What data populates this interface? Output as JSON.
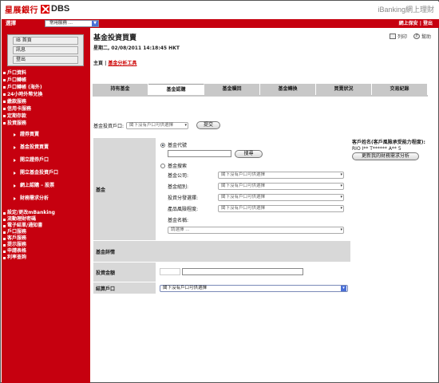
{
  "header": {
    "brand": "iBanking網上理財",
    "logo_cn": "星展銀行",
    "logo_en": "DBS"
  },
  "topbar": {
    "select_label": "選擇",
    "select_value": "常用服務 ...",
    "links": "網上保安 | 登出"
  },
  "sidebar": {
    "buttons": [
      "IB 首頁",
      "訊息",
      "登出"
    ],
    "items": [
      "戶口資料",
      "戶口轉帳",
      "戶口轉帳 (海外)",
      "24小時外幣兌換",
      "繳款服務",
      "信用卡服務",
      "定期存款",
      "投資服務"
    ],
    "subitems": [
      "證券買賣",
      "基金投資買賣",
      "開立證券戶口",
      "開立基金投資戶口",
      "網上認購 – 股票",
      "財務需求分析"
    ],
    "items2": [
      "設定/更改mBanking",
      "流動理財密碼",
      "電子結單/通知書",
      "戶口服務",
      "客戶服務",
      "提示服務",
      "申請表格",
      "利率查詢"
    ]
  },
  "page": {
    "title": "基金投資買賣",
    "datetime": "星期二, 02/08/2011 14:18:45 HKT",
    "crumb_home": "主頁",
    "crumb_link": "基金分析工具",
    "tools": {
      "print": "列印",
      "help": "幫助"
    }
  },
  "tabs": [
    "持有基金",
    "基金認購",
    "基金贖回",
    "基金轉換",
    "買賣狀況",
    "交易紀錄"
  ],
  "account": {
    "label": "基金投資戶口:",
    "value": "閣下沒有戶口可供選擇",
    "submit": "提交"
  },
  "form": {
    "fund_label": "基金",
    "radio_code": "基金代號",
    "search_btn": "搜尋",
    "radio_search": "基金搜索",
    "fields": [
      {
        "label": "基金公司:",
        "value": "閣下沒有戶口可供選擇"
      },
      {
        "label": "基金組別:",
        "value": "閣下沒有戶口可供選擇"
      },
      {
        "label": "投資分發選擇:",
        "value": "閣下沒有戶口可供選擇"
      },
      {
        "label": "產品風險程度:",
        "value": "閣下沒有戶口可供選擇"
      }
    ],
    "fund_name_label": "基金名稱:",
    "fund_name_value": "請選擇 ...",
    "detail_label": "基金詳情",
    "amount_label": "投資金額",
    "settle_label": "結算戶口",
    "settle_value": "閣下沒有戶口可供選擇"
  },
  "note": {
    "title": "客戶姓名(客戶風險承受能力程度):",
    "name": "RIO I** T****** A** 5",
    "update_btn": "更新我的財務需求分析"
  }
}
